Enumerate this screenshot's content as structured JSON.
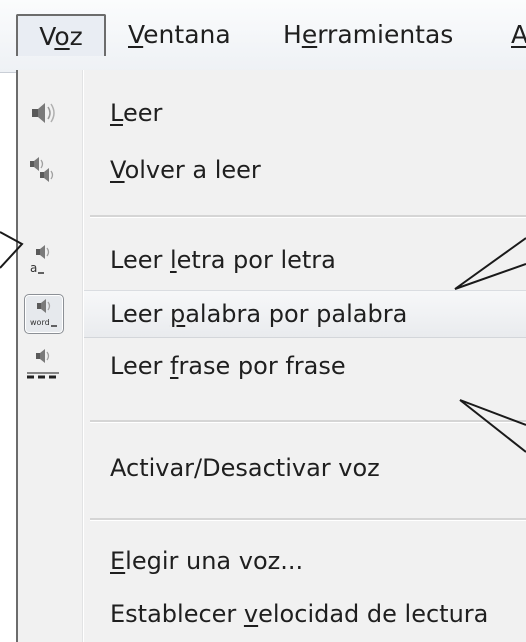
{
  "menubar": {
    "voz": {
      "pre": "V",
      "ul": "o",
      "post": "z"
    },
    "ventana": {
      "pre": "",
      "ul": "V",
      "post": "entana"
    },
    "herramientas": {
      "pre": "H",
      "ul": "e",
      "post": "rramientas"
    },
    "cut": {
      "pre": "",
      "ul": "A",
      "post": ""
    }
  },
  "menu": {
    "items": [
      {
        "pre": "",
        "ul": "L",
        "post": "eer",
        "icon": "speaker-icon"
      },
      {
        "pre": "",
        "ul": "V",
        "post": "olver a leer",
        "icon": "speakers-repeat-icon"
      },
      {
        "pre": "Leer ",
        "ul": "l",
        "post": "etra por letra",
        "icon": "speaker-letter-icon"
      },
      {
        "pre": "Leer ",
        "ul": "p",
        "post": "alabra por palabra",
        "icon": "speaker-word-icon",
        "selected": true
      },
      {
        "pre": "Leer ",
        "ul": "f",
        "post": "rase por frase",
        "icon": "speaker-sentence-icon"
      },
      {
        "pre": "Activar/Desactivar voz",
        "ul": "",
        "post": ""
      },
      {
        "pre": "",
        "ul": "E",
        "post": "legir una voz..."
      },
      {
        "pre": "Establecer ",
        "ul": "v",
        "post": "elocidad de lectura"
      }
    ],
    "icon_letter_text": "a",
    "icon_word_text": "word"
  },
  "colors": {
    "menu_background": "#f1f1f1",
    "menubar_background": "#eef1f5",
    "border": "#6c6c6c",
    "text": "#1f1f1f"
  }
}
